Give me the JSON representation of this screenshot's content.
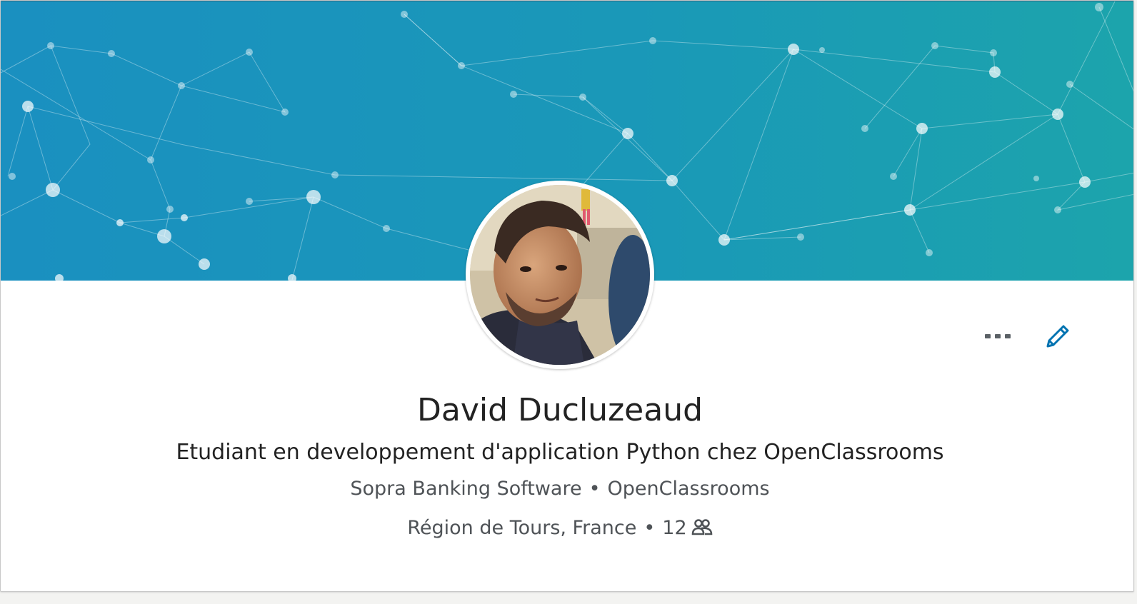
{
  "profile": {
    "name": "David Ducluzeaud",
    "headline": "Etudiant en developpement d'application Python chez OpenClassrooms",
    "current_company": "Sopra Banking Software",
    "education": "OpenClassrooms",
    "location": "Région de Tours, France",
    "connections": "12",
    "separator": "•"
  },
  "icons": {
    "more": "more-horizontal-icon",
    "edit": "pencil-icon",
    "connections": "people-icon"
  },
  "colors": {
    "banner_start": "#1a90c0",
    "banner_end": "#1ca4ac",
    "accent": "#0073b1",
    "text_primary": "#222222",
    "text_secondary": "#4f5357"
  }
}
